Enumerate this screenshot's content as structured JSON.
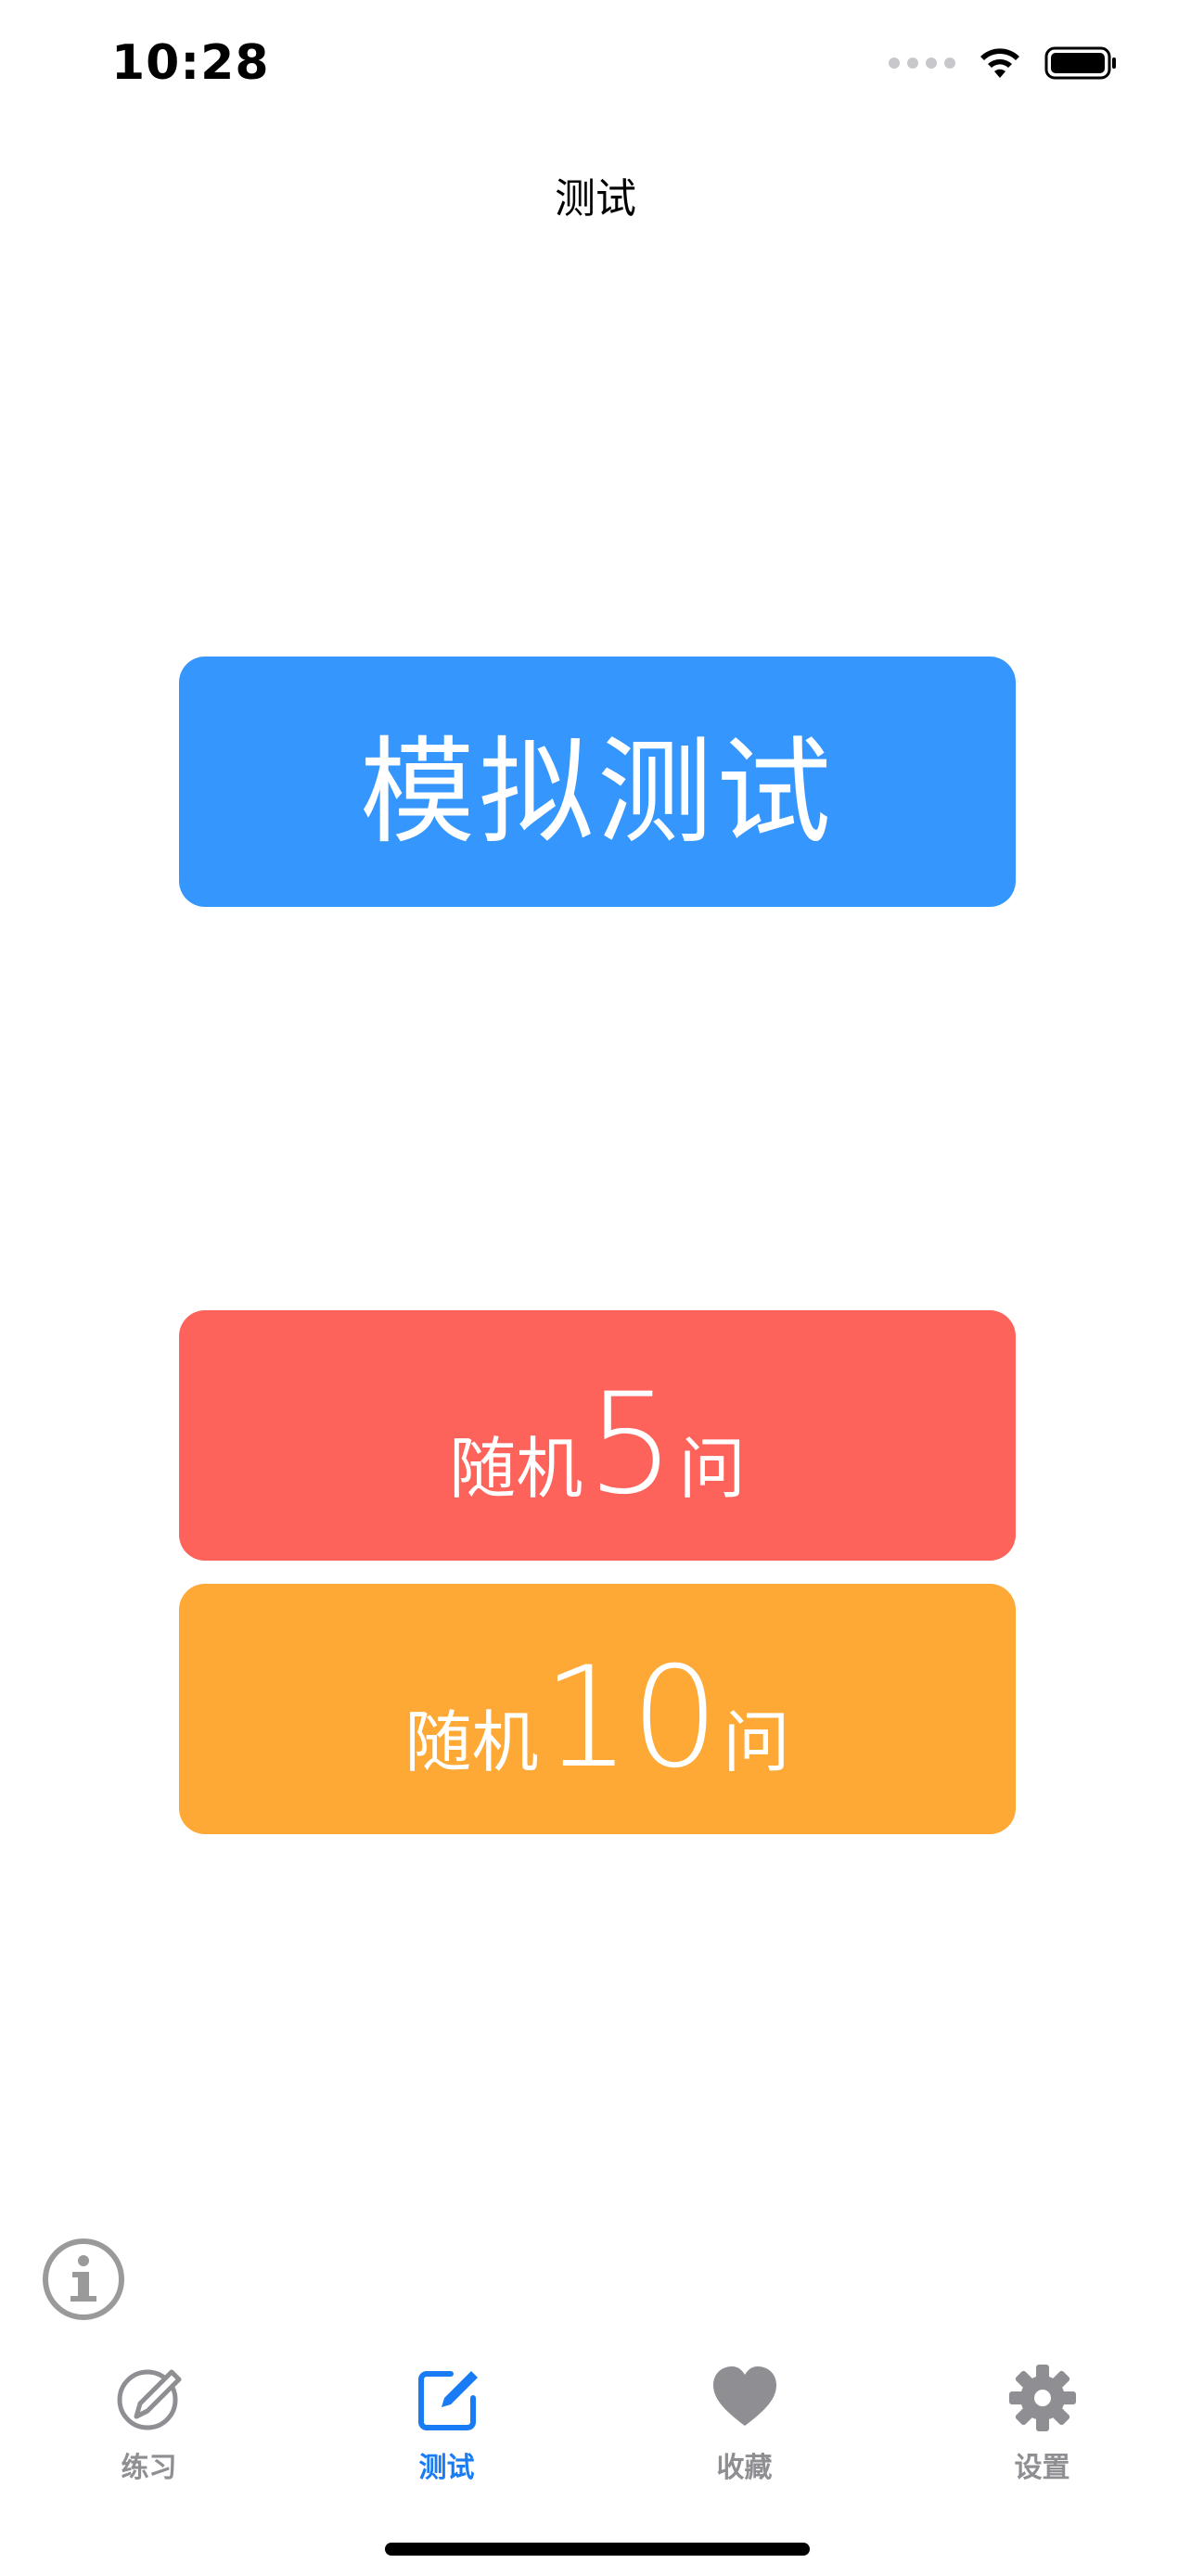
{
  "status_bar": {
    "time": "10:28"
  },
  "nav": {
    "title": "测试"
  },
  "buttons": {
    "simulated_test": "模拟测试",
    "random5": {
      "prefix": "随机",
      "number": "5",
      "suffix": "问"
    },
    "random10": {
      "prefix": "随机",
      "number": "10",
      "suffix": "问"
    }
  },
  "colors": {
    "accent_blue": "#3597fd",
    "red": "#fd625b",
    "orange": "#fea935",
    "tab_active": "#1a7cf4",
    "tab_inactive": "#8e8e93"
  },
  "tabs": [
    {
      "label": "练习",
      "icon": "pencil-circle-icon",
      "active": false
    },
    {
      "label": "测试",
      "icon": "square-pencil-icon",
      "active": true
    },
    {
      "label": "收藏",
      "icon": "heart-icon",
      "active": false
    },
    {
      "label": "设置",
      "icon": "gear-icon",
      "active": false
    }
  ]
}
